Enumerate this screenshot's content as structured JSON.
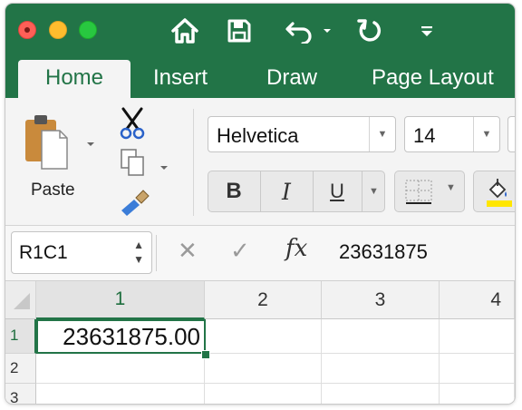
{
  "window_controls": {
    "close": "close",
    "minimize": "minimize",
    "zoom": "zoom"
  },
  "quick_access": [
    "home-icon",
    "save-icon",
    "undo-icon",
    "redo-icon",
    "customize-icon"
  ],
  "tabs": [
    {
      "label": "Home",
      "active": true
    },
    {
      "label": "Insert",
      "active": false
    },
    {
      "label": "Draw",
      "active": false
    },
    {
      "label": "Page Layout",
      "active": false
    }
  ],
  "ribbon": {
    "paste_label": "Paste",
    "font_name": "Helvetica",
    "font_size": "14",
    "bold_label": "B",
    "italic_label": "I",
    "underline_label": "U"
  },
  "formula_bar": {
    "name_box": "R1C1",
    "fx_label": "fx",
    "formula_value": "23631875"
  },
  "sheet": {
    "columns": [
      "1",
      "2",
      "3",
      "4"
    ],
    "rows": [
      "1",
      "2",
      "3"
    ],
    "active_cell_value": "23631875.00"
  },
  "colors": {
    "accent": "#227447",
    "fill_highlight": "#ffe600"
  }
}
